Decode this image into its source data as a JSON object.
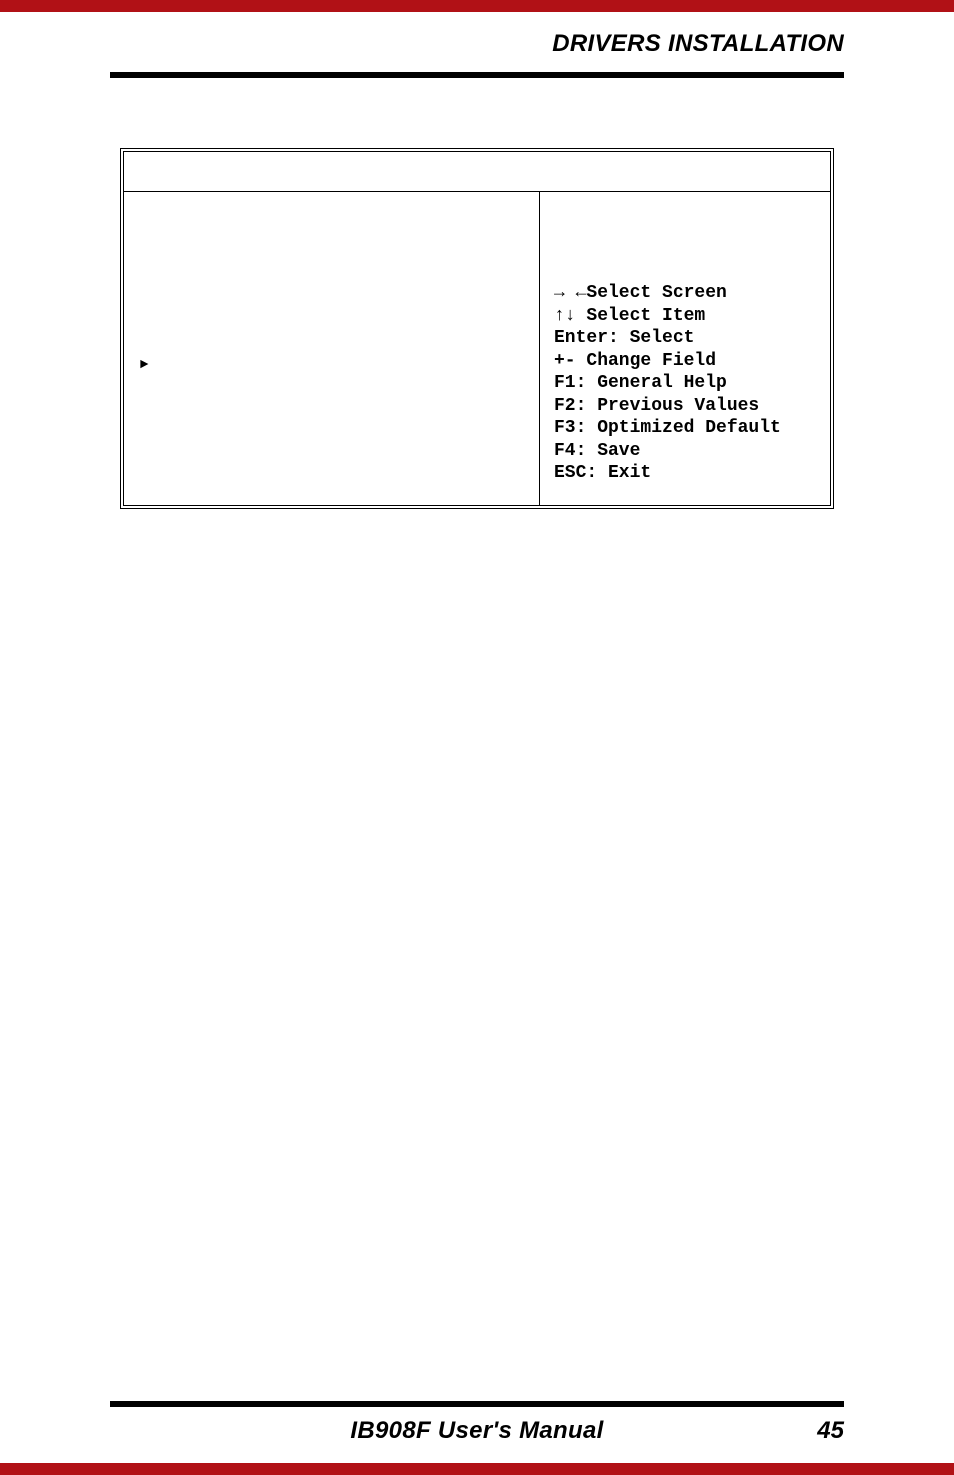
{
  "header": {
    "title": "DRIVERS INSTALLATION"
  },
  "bios": {
    "marker": "►",
    "help": {
      "select_screen": "→ ←Select Screen",
      "select_item": "↑↓ Select Item",
      "enter": "Enter: Select",
      "change": "+-  Change Field",
      "f1": "F1: General Help",
      "f2": "F2: Previous Values",
      "f3": "F3: Optimized Default",
      "f4": "F4: Save",
      "esc": "ESC: Exit"
    }
  },
  "footer": {
    "manual": "IB908F User's Manual",
    "page": "45"
  }
}
